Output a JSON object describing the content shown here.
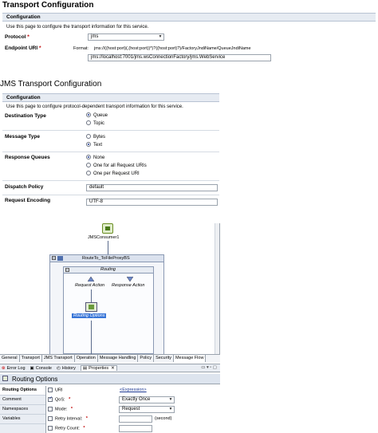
{
  "transport": {
    "title": "Transport Configuration",
    "section": "Configuration",
    "description": "Use this page to configure the transport information for this service.",
    "protocol_label": "Protocol",
    "protocol_value": "jms",
    "endpoint_label": "Endpoint URI",
    "required_mark": "*",
    "format_label": "Format:",
    "format_value": "jms://((host:port)(,(host:port))*)?((host:port)?)/FactoryJndiName/QueueJndiName",
    "endpoint_value": "jms://localhost:7001/jms.wsConnectionFactory/jms.WebService"
  },
  "jms": {
    "title": "JMS Transport Configuration",
    "section": "Configuration",
    "description": "Use this page to configure protocol-dependent transport information for this service.",
    "destination_type_label": "Destination Type",
    "destination_options": [
      "Queue",
      "Topic"
    ],
    "message_type_label": "Message Type",
    "message_options": [
      "Bytes",
      "Text"
    ],
    "response_queues_label": "Response Queues",
    "response_options": [
      "None",
      "One for all Request URIs",
      "One per Request URI"
    ],
    "dispatch_policy_label": "Dispatch Policy",
    "dispatch_policy_value": "default",
    "request_encoding_label": "Request Encoding",
    "request_encoding_value": "UTF-8"
  },
  "flow": {
    "consumer_label": "JMSConsumer1",
    "route_node_label": "RouteTo_ToFileProxyBS",
    "routing_label": "Routing",
    "request_action_label": "Request Action",
    "response_action_label": "Response Action",
    "routing_options_label": "Routing Options"
  },
  "editor_tabs": [
    "General",
    "Transport",
    "JMS Transport",
    "Operation",
    "Message Handling",
    "Policy",
    "Security",
    "Message Flow"
  ],
  "views": {
    "tabs": [
      "Error Log",
      "Console",
      "History",
      "Properties"
    ],
    "close_mark": "✕"
  },
  "properties": {
    "title": "Routing Options",
    "side_items": [
      "Routing Options",
      "Comment",
      "Namespaces",
      "Variables"
    ],
    "uri_label": "URI",
    "uri_link": "<Expression>",
    "qos_label": "QoS:",
    "qos_value": "Exactly Once",
    "mode_label": "Mode:",
    "mode_value": "Request",
    "retry_interval_label": "Retry Interval:",
    "retry_interval_unit": "(second)",
    "retry_count_label": "Retry Count:",
    "required_mark": "*"
  },
  "colors": {
    "section_bar": "#e6ebf2",
    "selection": "#3875d7",
    "required": "#c00000"
  }
}
